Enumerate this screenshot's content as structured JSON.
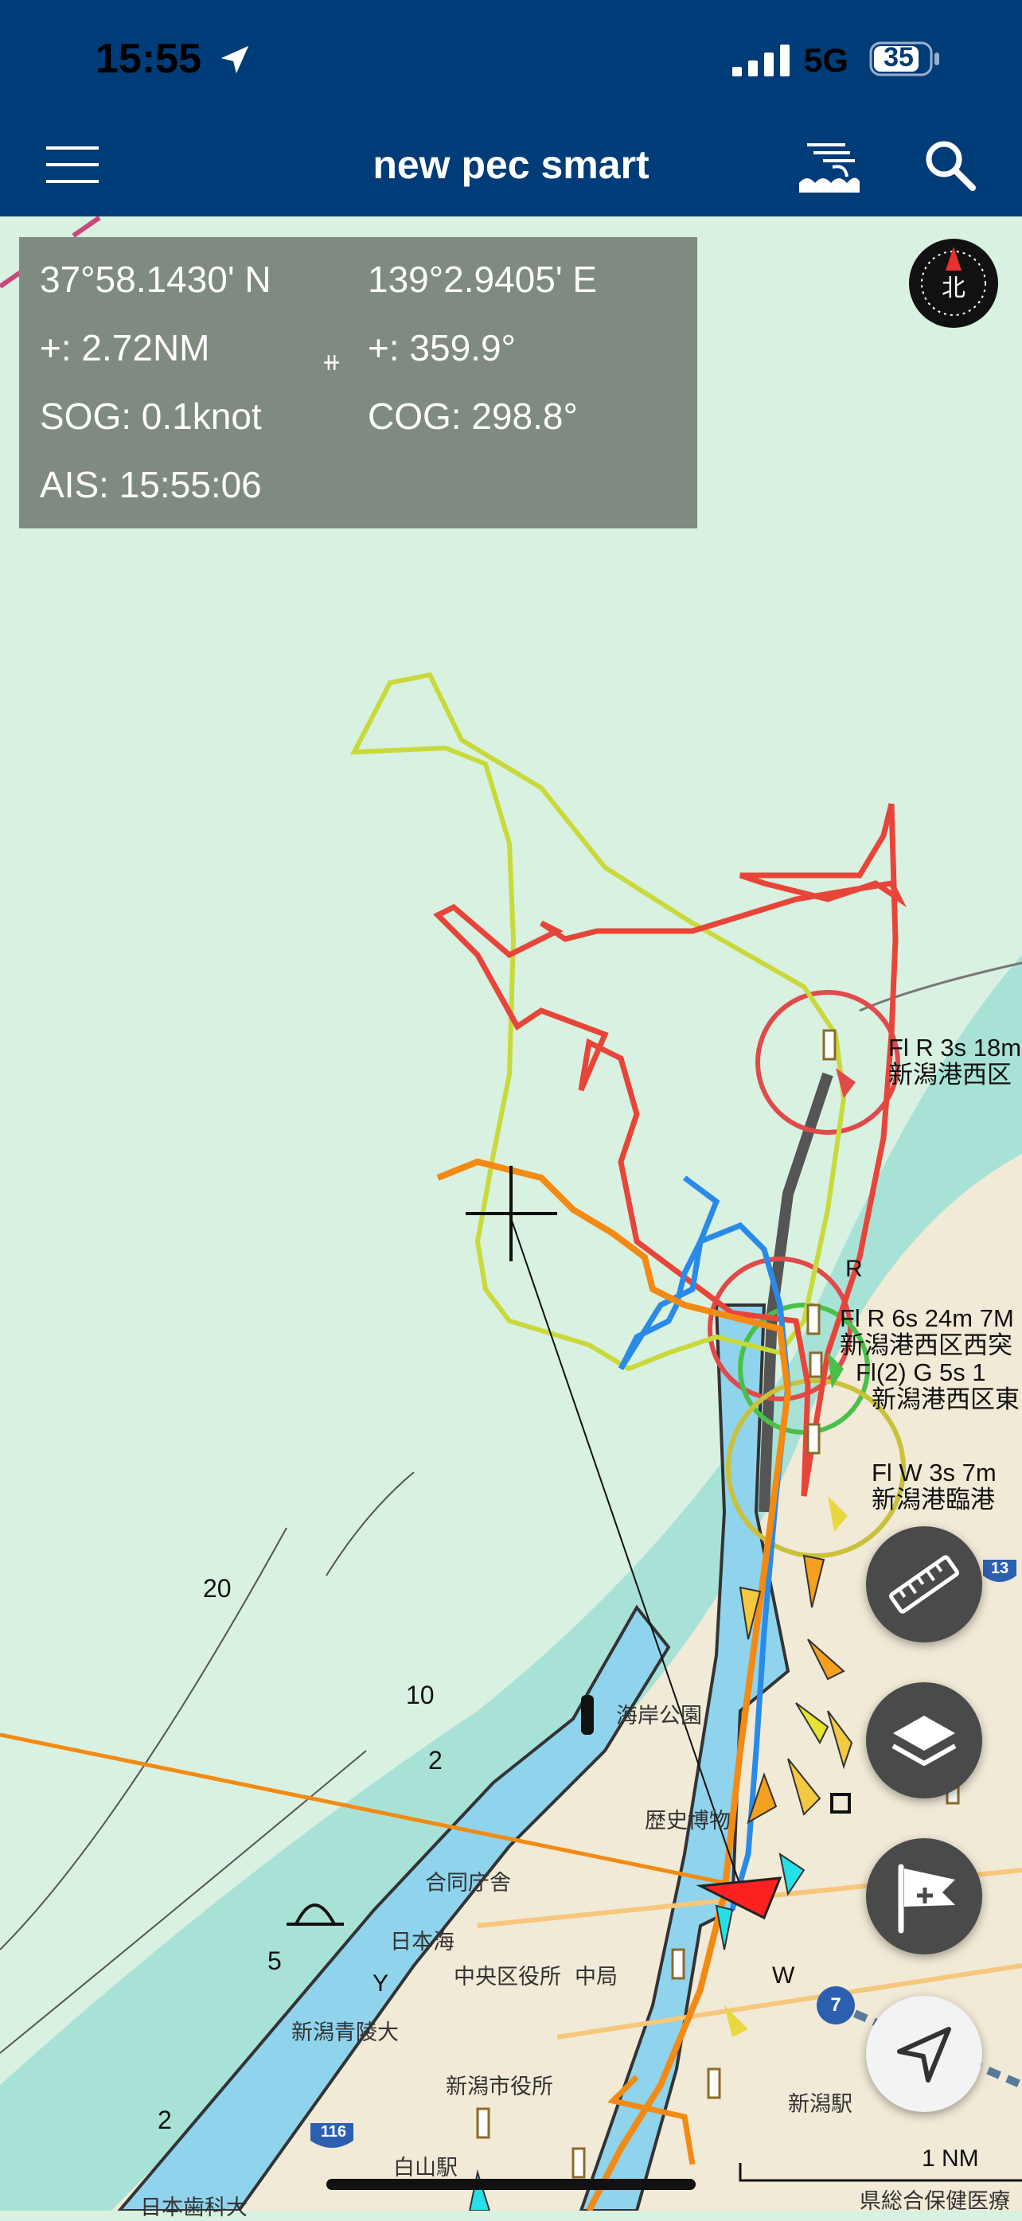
{
  "status_bar": {
    "time": "15:55",
    "network": "5G",
    "battery": "35"
  },
  "app_bar": {
    "title": "new pec smart",
    "menu_icon": "hamburger-menu-icon",
    "wave_icon": "tide-wave-icon",
    "search_icon": "search-icon"
  },
  "info_panel": {
    "latitude": "37°58.1430' N",
    "longitude": "139°2.9405' E",
    "distance": "+: 2.72NM",
    "bearing": "+: 359.9°",
    "sog": "SOG: 0.1knot",
    "cog": "COG: 298.8°",
    "ais": "AIS: 15:55:06",
    "cross_marker": "⧺"
  },
  "compass": {
    "label": "北"
  },
  "map_labels": {
    "light1_line1": "Fl R 3s 18m",
    "light1_line2": "新潟港西区",
    "light2_line1": "Fl R 6s 24m 7M",
    "light2_line2": "新潟港西区西突",
    "light2_line3": "Fl(2) G 5s 1",
    "light2_line4": "新潟港西区東",
    "light3_line1": "Fl W 3s 7m",
    "light3_line2": "新潟港臨港",
    "r_label": "R",
    "w_label": "W",
    "y_label": "Y",
    "depth_20": "20",
    "depth_10": "10",
    "depth_2a": "2",
    "depth_5": "5",
    "depth_2b": "2",
    "park": "海岸公園",
    "museum": "歴史博物",
    "gov_office": "合同庁舎",
    "nihonkai": "日本海",
    "chuo_ward": "中央区役所",
    "post_office": "中局",
    "aoryo": "新潟青陵大",
    "city_hall": "新潟市役所",
    "station": "新潟駅",
    "hakusan": "白山駅",
    "dental": "日本歯科大",
    "health": "県総合保健医療",
    "route_116": "116",
    "route_7": "7",
    "route_13": "13",
    "scale": "1 NM"
  },
  "fabs": {
    "measure": "ruler-icon",
    "layers": "layers-icon",
    "flag": "add-flag-icon",
    "locate": "navigation-arrow-icon"
  },
  "colors": {
    "header": "#003c78",
    "sea": "#d8f1e0",
    "shallow": "#a8e2d6",
    "land": "#f1ead7",
    "track_red": "#e8453a",
    "track_yellow": "#c9d93a",
    "track_orange": "#f28a14",
    "track_blue": "#2a8ae8",
    "own_ship": "#ff2020"
  }
}
